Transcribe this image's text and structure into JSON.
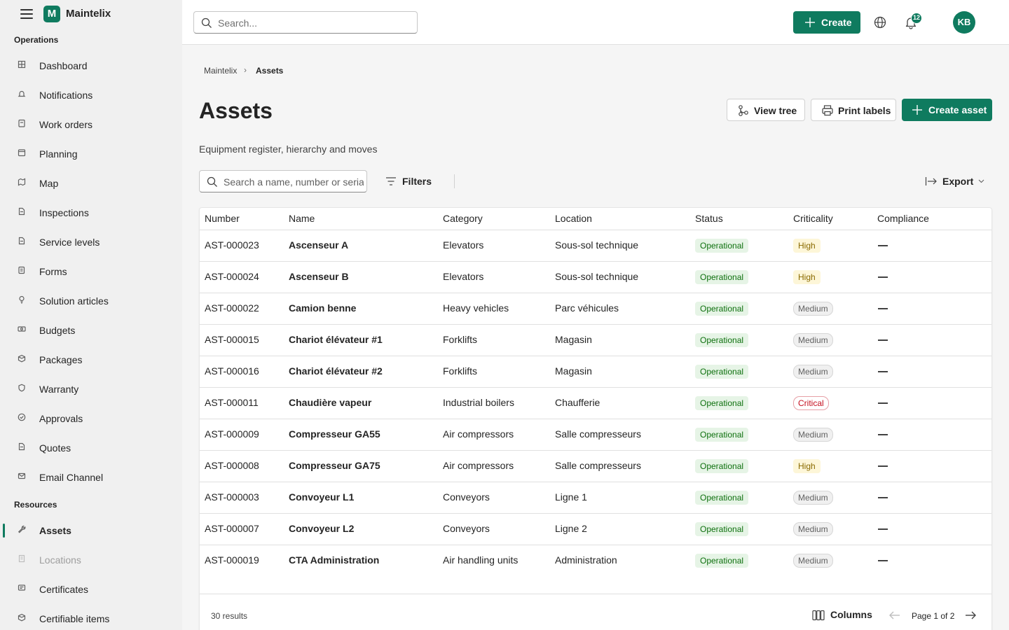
{
  "app": {
    "name": "Maintelix",
    "logo_letter": "M",
    "accent": "#0f7b5f"
  },
  "topbar": {
    "search_placeholder": "Search...",
    "create_label": "Create",
    "notifications_count": "12",
    "user_initials": "KB"
  },
  "sidebar": {
    "sections": [
      {
        "label": "Operations"
      },
      {
        "label": "Resources"
      }
    ],
    "items": [
      {
        "label": "Dashboard",
        "icon": "dashboard-icon"
      },
      {
        "label": "Notifications",
        "icon": "bell-icon"
      },
      {
        "label": "Work orders",
        "icon": "clipboard-icon"
      },
      {
        "label": "Planning",
        "icon": "calendar-icon"
      },
      {
        "label": "Map",
        "icon": "map-icon"
      },
      {
        "label": "Inspections",
        "icon": "document-icon"
      },
      {
        "label": "Service levels",
        "icon": "document-icon"
      },
      {
        "label": "Forms",
        "icon": "form-icon"
      },
      {
        "label": "Solution articles",
        "icon": "lightbulb-icon"
      },
      {
        "label": "Budgets",
        "icon": "money-icon"
      },
      {
        "label": "Packages",
        "icon": "box-icon"
      },
      {
        "label": "Warranty",
        "icon": "shield-icon"
      },
      {
        "label": "Approvals",
        "icon": "check-circle-icon"
      },
      {
        "label": "Quotes",
        "icon": "document-icon"
      },
      {
        "label": "Email Channel",
        "icon": "mail-icon"
      },
      {
        "label": "Assets",
        "icon": "wrench-icon",
        "active": true
      },
      {
        "label": "Locations",
        "icon": "building-icon",
        "disabled": true
      },
      {
        "label": "Certificates",
        "icon": "certificate-icon"
      },
      {
        "label": "Certifiable items",
        "icon": "box-icon"
      }
    ]
  },
  "breadcrumb": {
    "root": "Maintelix",
    "current": "Assets"
  },
  "page": {
    "title": "Assets",
    "subtitle": "Equipment register, hierarchy and moves",
    "view_tree_label": "View tree",
    "print_labels_label": "Print labels",
    "create_asset_label": "Create asset",
    "filter_placeholder": "Search a name, number or serial",
    "filters_label": "Filters",
    "export_label": "Export"
  },
  "table": {
    "columns": [
      "Number",
      "Name",
      "Category",
      "Location",
      "Status",
      "Criticality",
      "Compliance"
    ],
    "rows": [
      {
        "number": "AST-000023",
        "name": "Ascenseur A",
        "category": "Elevators",
        "location": "Sous-sol technique",
        "status": "Operational",
        "criticality": "High",
        "crit_kind": "high"
      },
      {
        "number": "AST-000024",
        "name": "Ascenseur B",
        "category": "Elevators",
        "location": "Sous-sol technique",
        "status": "Operational",
        "criticality": "High",
        "crit_kind": "high"
      },
      {
        "number": "AST-000022",
        "name": "Camion benne",
        "category": "Heavy vehicles",
        "location": "Parc véhicules",
        "status": "Operational",
        "criticality": "Medium",
        "crit_kind": "medium"
      },
      {
        "number": "AST-000015",
        "name": "Chariot élévateur #1",
        "category": "Forklifts",
        "location": "Magasin",
        "status": "Operational",
        "criticality": "Medium",
        "crit_kind": "medium"
      },
      {
        "number": "AST-000016",
        "name": "Chariot élévateur #2",
        "category": "Forklifts",
        "location": "Magasin",
        "status": "Operational",
        "criticality": "Medium",
        "crit_kind": "medium"
      },
      {
        "number": "AST-000011",
        "name": "Chaudière vapeur",
        "category": "Industrial boilers",
        "location": "Chaufferie",
        "status": "Operational",
        "criticality": "Critical",
        "crit_kind": "critical"
      },
      {
        "number": "AST-000009",
        "name": "Compresseur GA55",
        "category": "Air compressors",
        "location": "Salle compresseurs",
        "status": "Operational",
        "criticality": "Medium",
        "crit_kind": "medium"
      },
      {
        "number": "AST-000008",
        "name": "Compresseur GA75",
        "category": "Air compressors",
        "location": "Salle compresseurs",
        "status": "Operational",
        "criticality": "High",
        "crit_kind": "high"
      },
      {
        "number": "AST-000003",
        "name": "Convoyeur L1",
        "category": "Conveyors",
        "location": "Ligne 1",
        "status": "Operational",
        "criticality": "Medium",
        "crit_kind": "medium"
      },
      {
        "number": "AST-000007",
        "name": "Convoyeur L2",
        "category": "Conveyors",
        "location": "Ligne 2",
        "status": "Operational",
        "criticality": "Medium",
        "crit_kind": "medium"
      },
      {
        "number": "AST-000019",
        "name": "CTA Administration",
        "category": "Air handling units",
        "location": "Administration",
        "status": "Operational",
        "criticality": "Medium",
        "crit_kind": "medium"
      }
    ],
    "results_label": "30 results",
    "columns_button_label": "Columns",
    "page_label": "Page 1 of 2"
  }
}
